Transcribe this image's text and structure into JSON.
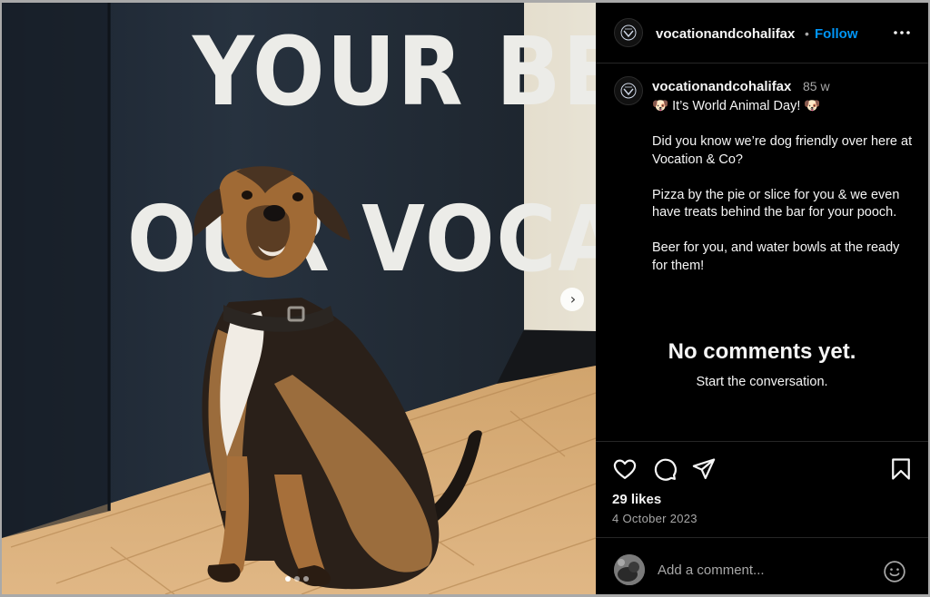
{
  "post": {
    "username": "vocationandcohalifax",
    "follow_label": "Follow",
    "separator": "•",
    "time_ago": "85 w",
    "caption_lines": [
      "🐶 It’s World Animal Day! 🐶",
      "Did you know we’re dog friendly over here at Vocation & Co?",
      "Pizza by the pie or slice for you & we even have treats behind the bar for your pooch.",
      "Beer for you, and water bowls at the ready for them!"
    ],
    "likes": "29 likes",
    "date": "4 October 2023"
  },
  "photo": {
    "wall_line_1": "YOUR BEER",
    "wall_line_2": "OUR VOCATION",
    "slides_total": 3,
    "slide_active": 1
  },
  "comments": {
    "empty_title": "No comments yet.",
    "empty_subtitle": "Start the conversation.",
    "input_placeholder": "Add a comment..."
  },
  "icons": {
    "like": "heart-icon",
    "comment": "comment-icon",
    "share": "share-icon",
    "save": "bookmark-icon",
    "more": "more-icon",
    "emoji": "emoji-icon",
    "next": "chevron-right-icon"
  },
  "colors": {
    "background": "#000000",
    "accent": "#0095f6",
    "divider": "#262626",
    "secondary_text": "#a8a8a8"
  }
}
